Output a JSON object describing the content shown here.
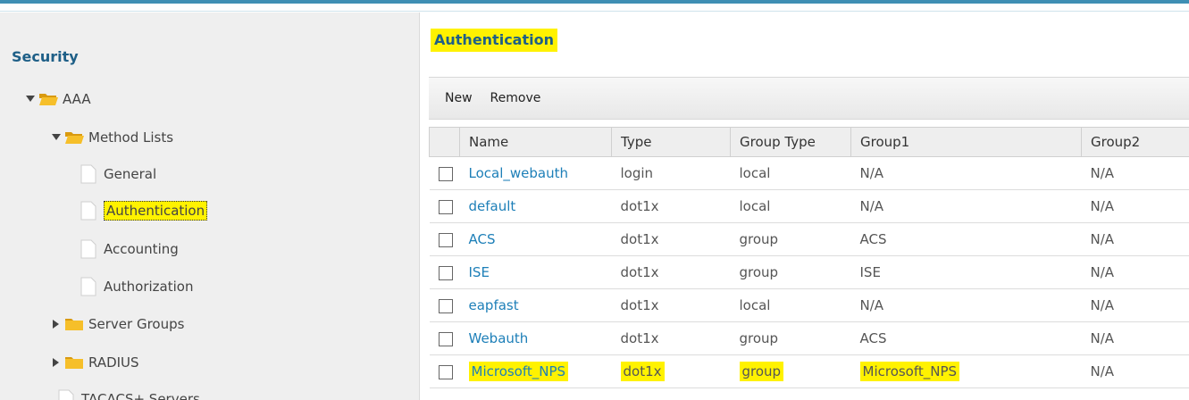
{
  "sidebar": {
    "title": "Security",
    "tree": {
      "aaa": "AAA",
      "method_lists": "Method Lists",
      "general": "General",
      "authentication": "Authentication",
      "accounting": "Accounting",
      "authorization": "Authorization",
      "server_groups": "Server Groups",
      "radius": "RADIUS",
      "tacacs": "TACACS+ Servers"
    }
  },
  "main": {
    "title": "Authentication",
    "toolbar": {
      "new_label": "New",
      "remove_label": "Remove"
    },
    "columns": [
      "Name",
      "Type",
      "Group Type",
      "Group1",
      "Group2"
    ],
    "rows": [
      {
        "name": "Local_webauth",
        "type": "login",
        "group_type": "local",
        "group1": "N/A",
        "group2": "N/A"
      },
      {
        "name": "default",
        "type": "dot1x",
        "group_type": "local",
        "group1": "N/A",
        "group2": "N/A"
      },
      {
        "name": "ACS",
        "type": "dot1x",
        "group_type": "group",
        "group1": "ACS",
        "group2": "N/A"
      },
      {
        "name": "ISE",
        "type": "dot1x",
        "group_type": "group",
        "group1": "ISE",
        "group2": "N/A"
      },
      {
        "name": "eapfast",
        "type": "dot1x",
        "group_type": "local",
        "group1": "N/A",
        "group2": "N/A"
      },
      {
        "name": "Webauth",
        "type": "dot1x",
        "group_type": "group",
        "group1": "ACS",
        "group2": "N/A"
      },
      {
        "name": "Microsoft_NPS",
        "type": "dot1x",
        "group_type": "group",
        "group1": "Microsoft_NPS",
        "group2": "N/A"
      }
    ]
  },
  "colors": {
    "accent": "#1e5f87",
    "link": "#1d7fb8",
    "highlight": "#fff200",
    "folder": "#f2b51c"
  }
}
